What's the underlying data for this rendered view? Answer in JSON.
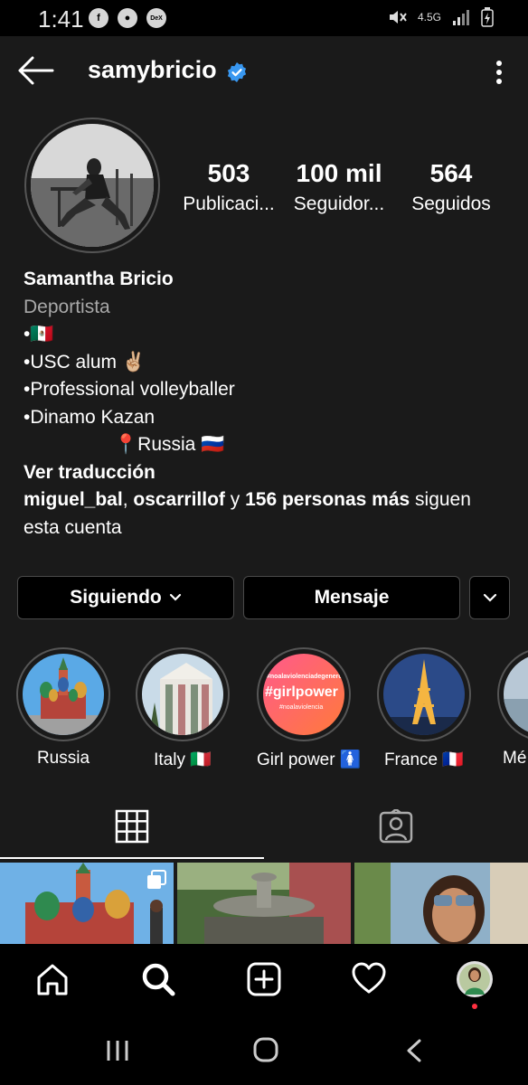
{
  "status_bar": {
    "time": "1:41",
    "network": "4.5G",
    "dex_label": "DeX"
  },
  "profile": {
    "username": "samybricio",
    "verified": true,
    "stats": [
      {
        "value": "503",
        "label": "Publicaci..."
      },
      {
        "value": "100 mil",
        "label": "Seguidor..."
      },
      {
        "value": "564",
        "label": "Seguidos"
      }
    ],
    "name": "Samantha Bricio",
    "category": "Deportista",
    "bio_lines": [
      "•🇲🇽",
      "•USC alum ✌🏼",
      "•Professional volleyballer",
      "•Dinamo Kazan",
      "📍Russia 🇷🇺"
    ],
    "translate": "Ver traducción",
    "followed_by": {
      "user1": "miguel_bal",
      "sep": ", ",
      "user2": "oscarrillof",
      "and": " y ",
      "others": "156 personas más",
      "rest_line1": " siguen",
      "rest_line2": "esta cuenta"
    }
  },
  "buttons": {
    "following": "Siguiendo",
    "message": "Mensaje"
  },
  "highlights": [
    {
      "label": "Russia"
    },
    {
      "label": "Italy 🇮🇹"
    },
    {
      "label": "Girl power 🚺",
      "overlay_top": "#noalaviolenciadegenero",
      "overlay_main": "#girlpower",
      "overlay_sub": "#noalaviolencia"
    },
    {
      "label": "France 🇫🇷"
    },
    {
      "label": "Mé"
    }
  ],
  "tabs": {
    "active": "grid"
  },
  "colors": {
    "background": "#000000",
    "surface": "#1a1a1a",
    "verified": "#3897f0",
    "notification": "#ff3040"
  }
}
